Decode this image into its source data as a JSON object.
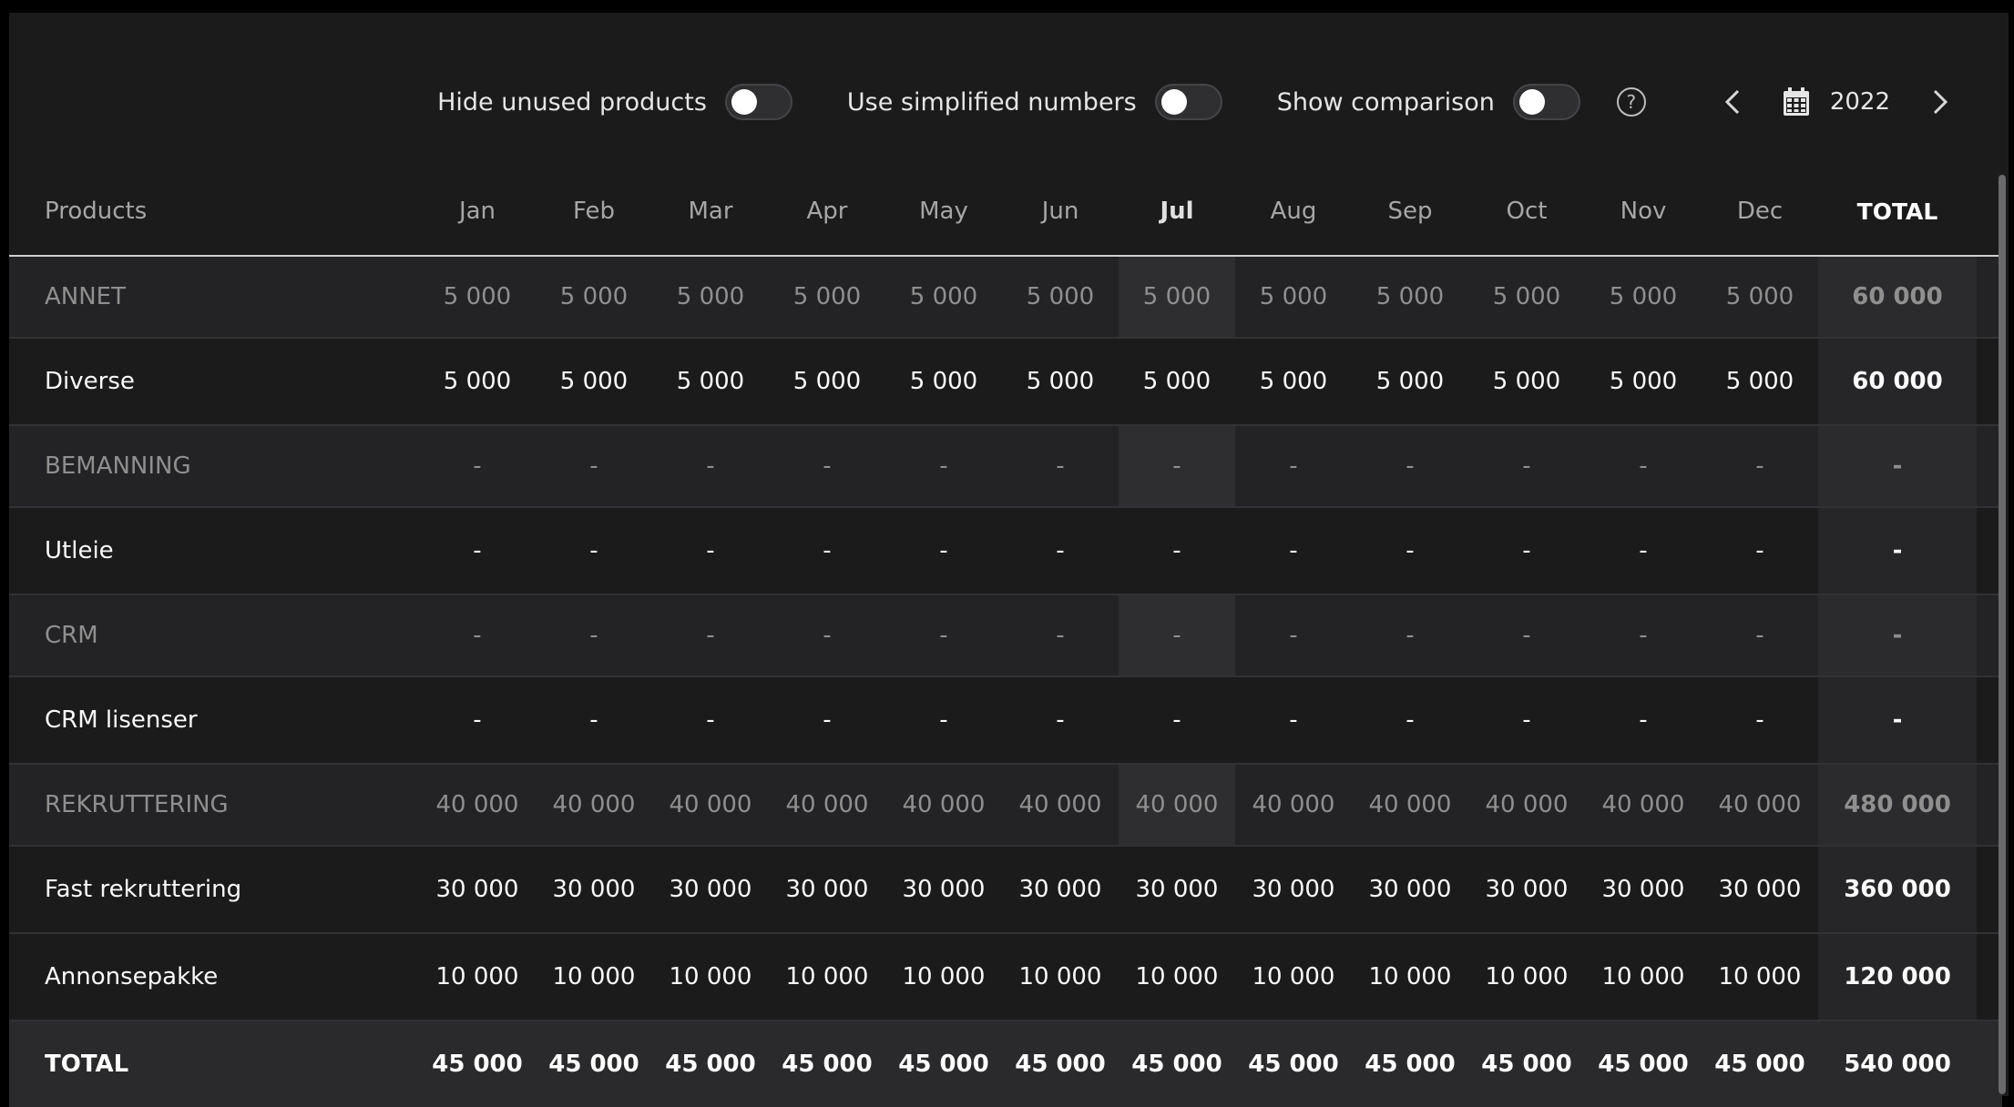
{
  "toolbar": {
    "toggles": [
      {
        "label": "Hide unused products",
        "on": false
      },
      {
        "label": "Use simplified numbers",
        "on": false
      },
      {
        "label": "Show comparison",
        "on": false
      }
    ],
    "help_glyph": "?",
    "year": "2022",
    "icons": [
      "help-icon",
      "chevron-left-icon",
      "calendar-icon",
      "chevron-right-icon"
    ]
  },
  "table": {
    "header": {
      "products": "Products",
      "months": [
        "Jan",
        "Feb",
        "Mar",
        "Apr",
        "May",
        "Jun",
        "Jul",
        "Aug",
        "Sep",
        "Oct",
        "Nov",
        "Dec"
      ],
      "total": "TOTAL"
    },
    "rows": [
      {
        "kind": "group",
        "name": "ANNET",
        "values": [
          "5 000",
          "5 000",
          "5 000",
          "5 000",
          "5 000",
          "5 000",
          "5 000",
          "5 000",
          "5 000",
          "5 000",
          "5 000",
          "5 000"
        ],
        "total": "60 000"
      },
      {
        "kind": "product",
        "name": "Diverse",
        "values": [
          "5 000",
          "5 000",
          "5 000",
          "5 000",
          "5 000",
          "5 000",
          "5 000",
          "5 000",
          "5 000",
          "5 000",
          "5 000",
          "5 000"
        ],
        "total": "60 000"
      },
      {
        "kind": "group",
        "name": "BEMANNING",
        "values": [
          "-",
          "-",
          "-",
          "-",
          "-",
          "-",
          "-",
          "-",
          "-",
          "-",
          "-",
          "-"
        ],
        "total": "-"
      },
      {
        "kind": "product",
        "name": "Utleie",
        "values": [
          "-",
          "-",
          "-",
          "-",
          "-",
          "-",
          "-",
          "-",
          "-",
          "-",
          "-",
          "-"
        ],
        "total": "-"
      },
      {
        "kind": "group",
        "name": "CRM",
        "values": [
          "-",
          "-",
          "-",
          "-",
          "-",
          "-",
          "-",
          "-",
          "-",
          "-",
          "-",
          "-"
        ],
        "total": "-"
      },
      {
        "kind": "product",
        "name": "CRM lisenser",
        "values": [
          "-",
          "-",
          "-",
          "-",
          "-",
          "-",
          "-",
          "-",
          "-",
          "-",
          "-",
          "-"
        ],
        "total": "-"
      },
      {
        "kind": "group",
        "name": "REKRUTTERING",
        "values": [
          "40 000",
          "40 000",
          "40 000",
          "40 000",
          "40 000",
          "40 000",
          "40 000",
          "40 000",
          "40 000",
          "40 000",
          "40 000",
          "40 000"
        ],
        "total": "480 000"
      },
      {
        "kind": "product",
        "name": "Fast rekruttering",
        "values": [
          "30 000",
          "30 000",
          "30 000",
          "30 000",
          "30 000",
          "30 000",
          "30 000",
          "30 000",
          "30 000",
          "30 000",
          "30 000",
          "30 000"
        ],
        "total": "360 000"
      },
      {
        "kind": "product",
        "name": "Annonsepakke",
        "values": [
          "10 000",
          "10 000",
          "10 000",
          "10 000",
          "10 000",
          "10 000",
          "10 000",
          "10 000",
          "10 000",
          "10 000",
          "10 000",
          "10 000"
        ],
        "total": "120 000"
      }
    ],
    "footer": {
      "name": "TOTAL",
      "values": [
        "45 000",
        "45 000",
        "45 000",
        "45 000",
        "45 000",
        "45 000",
        "45 000",
        "45 000",
        "45 000",
        "45 000",
        "45 000",
        "45 000"
      ],
      "total": "540 000"
    },
    "highlight_month": "Jul"
  }
}
